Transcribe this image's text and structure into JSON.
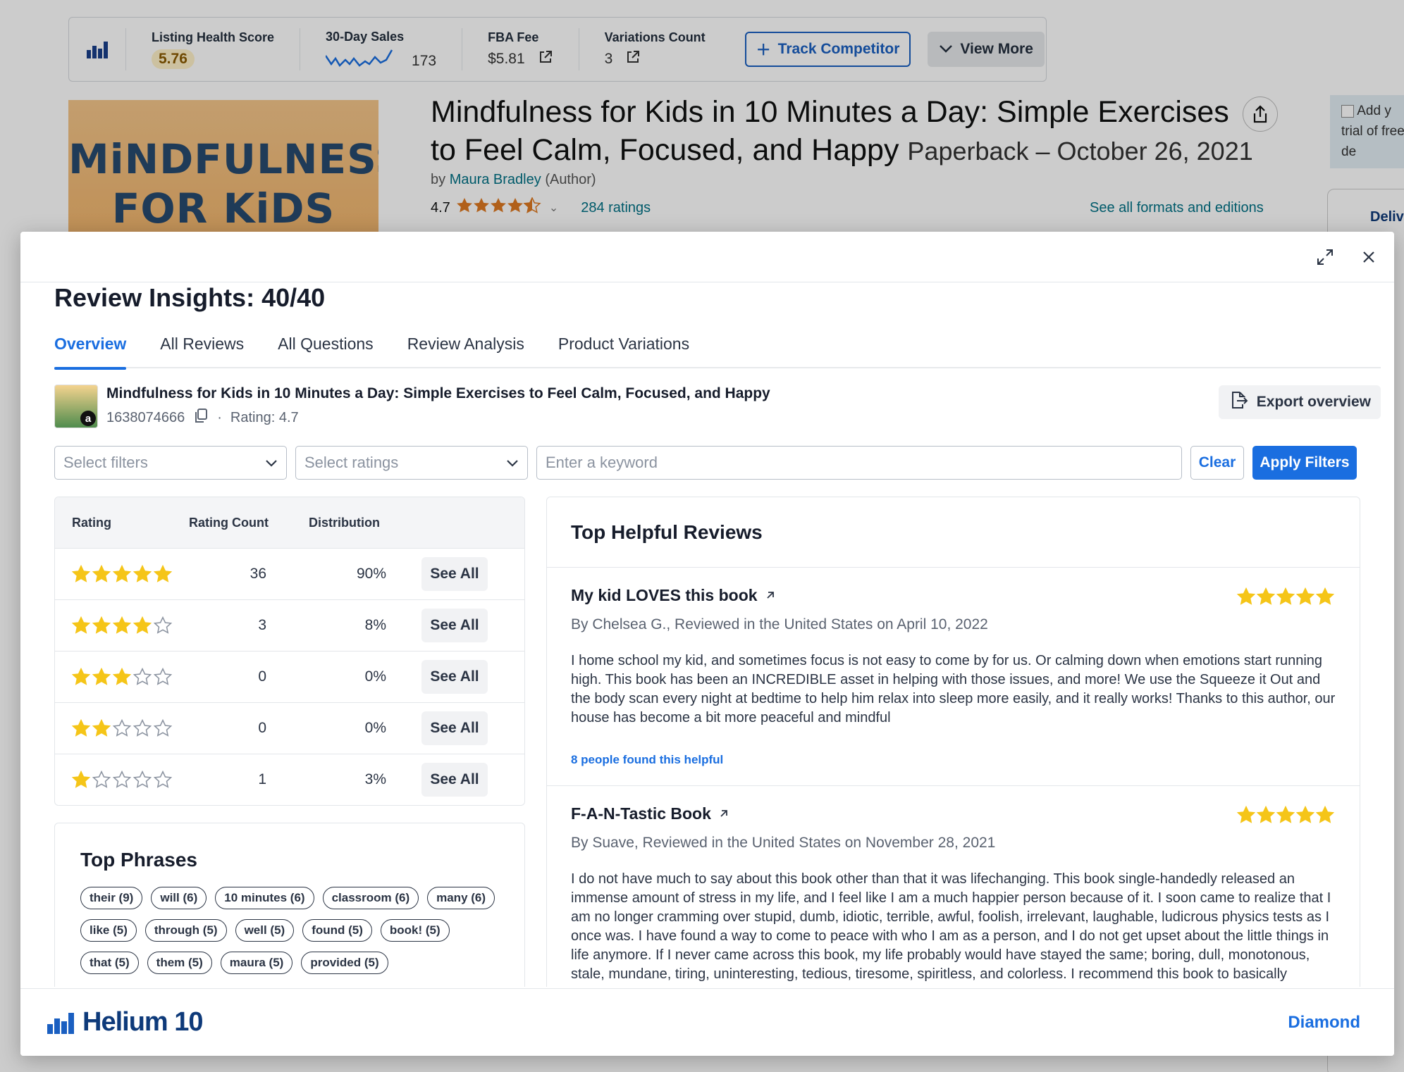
{
  "h10_bar": {
    "listing_health_label": "Listing Health Score",
    "listing_health_value": "5.76",
    "sales_label": "30-Day Sales",
    "sales_value": "173",
    "fba_label": "FBA Fee",
    "fba_value": "$5.81",
    "variations_label": "Variations Count",
    "variations_value": "3",
    "track_label": "Track Competitor",
    "view_more_label": "View More"
  },
  "product_page": {
    "cover_line1": "MiNDFULNESS",
    "cover_line2": "FOR KiDS",
    "title": "Mindfulness for Kids in 10 Minutes a Day: Simple Exercises to Feel Calm, Focused, and Happy",
    "format": "Paperback – October 26, 2021",
    "by": "by",
    "author": "Maura Bradley",
    "author_role": "(Author)",
    "rating": "4.7",
    "ratings_count": "284 ratings",
    "formats_link": "See all formats and editions",
    "side_box_text": "Add y trial of free de",
    "side_tab": "Deliv"
  },
  "modal": {
    "title": "Review Insights: 40/40",
    "tabs": [
      {
        "label": "Overview",
        "active": true
      },
      {
        "label": "All Reviews"
      },
      {
        "label": "All Questions"
      },
      {
        "label": "Review Analysis"
      },
      {
        "label": "Product Variations"
      }
    ],
    "product": {
      "name": "Mindfulness for Kids in 10 Minutes a Day: Simple Exercises to Feel Calm, Focused, and Happy",
      "asin": "1638074666",
      "rating": "Rating: 4.7",
      "separator": "·"
    },
    "export_label": "Export overview",
    "filters": {
      "filters_placeholder": "Select filters",
      "ratings_placeholder": "Select ratings",
      "keyword_placeholder": "Enter a keyword",
      "clear_label": "Clear",
      "apply_label": "Apply Filters"
    },
    "rating_table": {
      "headers": [
        "Rating",
        "Rating Count",
        "Distribution"
      ],
      "rows": [
        {
          "stars": 5,
          "count": "36",
          "dist": "90%",
          "action": "See All"
        },
        {
          "stars": 4,
          "count": "3",
          "dist": "8%",
          "action": "See All"
        },
        {
          "stars": 3,
          "count": "0",
          "dist": "0%",
          "action": "See All"
        },
        {
          "stars": 2,
          "count": "0",
          "dist": "0%",
          "action": "See All"
        },
        {
          "stars": 1,
          "count": "1",
          "dist": "3%",
          "action": "See All"
        }
      ]
    },
    "top_phrases": {
      "title": "Top Phrases",
      "chips": [
        "their (9)",
        "will (6)",
        "10 minutes (6)",
        "classroom (6)",
        "many (6)",
        "like (5)",
        "through (5)",
        "well (5)",
        "found (5)",
        "book! (5)",
        "that (5)",
        "them (5)",
        "maura (5)",
        "provided (5)"
      ]
    },
    "top_reviews": {
      "title": "Top Helpful Reviews",
      "reviews": [
        {
          "title": "My kid LOVES this book",
          "stars": 5,
          "by": "By Chelsea G., Reviewed in the United States on April 10, 2022",
          "text": "I home school my kid, and sometimes focus is not easy to come by for us. Or calming down when emotions start running high. This book has been an INCREDIBLE asset in helping with those issues, and more! We use the Squeeze it Out and the body scan every night at bedtime to help him relax into sleep more easily, and it really works! Thanks to this author, our house has become a bit more peaceful and mindful",
          "helpful": "8 people found this helpful"
        },
        {
          "title": "F-A-N-Tastic Book",
          "stars": 5,
          "by": "By Suave, Reviewed in the United States on November 28, 2021",
          "text": "I do not have much to say about this book other than that it was lifechanging. This book single-handedly released an immense amount of stress in my life, and I feel like I am a much happier person because of it. I soon came to realize that I am no longer cramming over stupid, dumb, idiotic, terrible, awful, foolish, irrelevant, laughable, ludicrous physics tests as I once was. I have found a way to come to peace with who I am as a person, and I do not get upset about the little things in life anymore. If I never came across this book, my life probably would have stayed the same; boring, dull, monotonous, stale, mundane, tiring, uninteresting, tedious, tiresome, spiritless, and colorless. I recommend this book to basically anyone who is stressed out or needs something to help make them an overall",
          "helpful": ""
        }
      ]
    },
    "footer": {
      "brand": "Helium 10",
      "plan": "Diamond"
    }
  },
  "colors": {
    "accent": "#1a6ee0",
    "star": "#f5c518",
    "amazon_link": "#007185"
  }
}
